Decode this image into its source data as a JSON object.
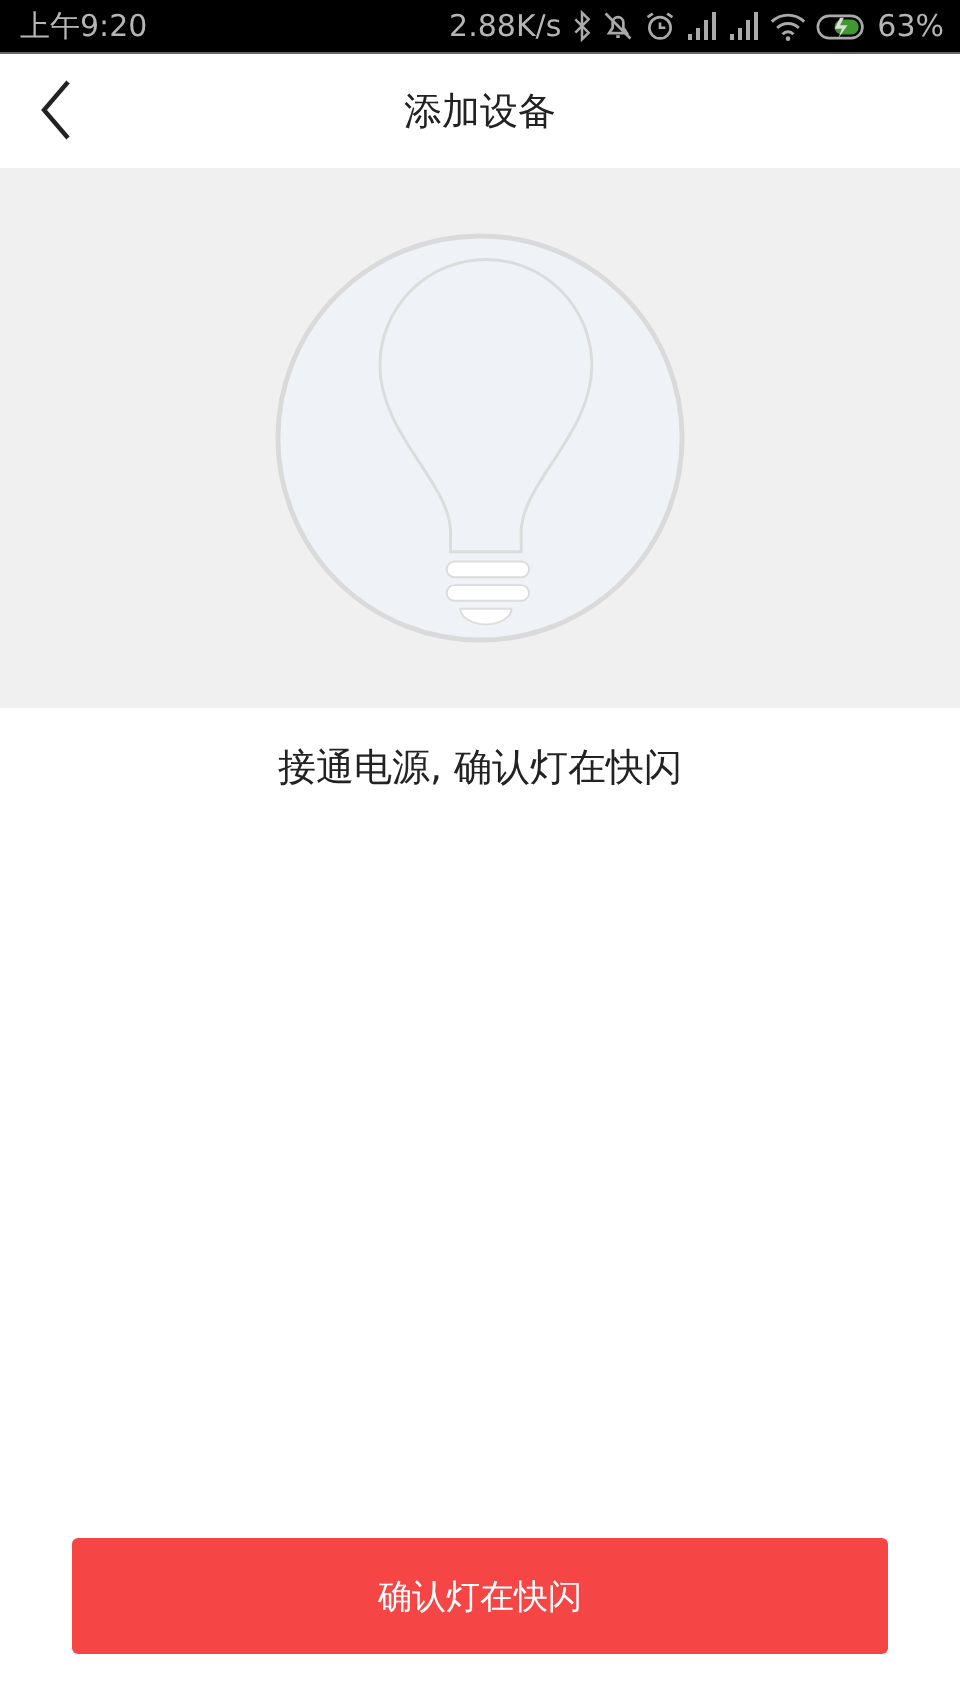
{
  "status_bar": {
    "time": "上午9:20",
    "speed": "2.88K/s",
    "battery": "63%"
  },
  "header": {
    "title": "添加设备"
  },
  "instruction": "接通电源, 确认灯在快闪",
  "confirm_button": "确认灯在快闪"
}
